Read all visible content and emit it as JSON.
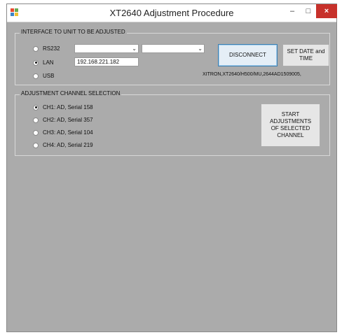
{
  "window": {
    "title": "XT2640 Adjustment Procedure",
    "minimize_glyph": "–",
    "maximize_glyph": "□",
    "close_glyph": "×",
    "icon": "app-icon"
  },
  "interface_group": {
    "legend": "INTERFACE TO UNIT TO BE ADJUSTED",
    "options": [
      {
        "label": "RS232",
        "selected": false
      },
      {
        "label": "LAN",
        "selected": true
      },
      {
        "label": "USB",
        "selected": false
      }
    ],
    "lan_address": "192.168.221.182",
    "disconnect_label": "DISCONNECT",
    "set_date_label": "SET DATE and TIME",
    "device_identity": "XITRON,XT2640/H500/MU,2644AD1509005,"
  },
  "channel_group": {
    "legend": "ADJUSTMENT CHANNEL SELECTION",
    "channels": [
      {
        "label": "CH1: AD, Serial 158",
        "selected": true
      },
      {
        "label": "CH2: AD, Serial 357",
        "selected": false
      },
      {
        "label": "CH3: AD, Serial 104",
        "selected": false
      },
      {
        "label": "CH4: AD, Serial 219",
        "selected": false
      }
    ],
    "start_label": "START ADJUSTMENTS OF SELECTED CHANNEL"
  },
  "colors": {
    "client_background": "#ababab",
    "close_button": "#c7312b"
  }
}
